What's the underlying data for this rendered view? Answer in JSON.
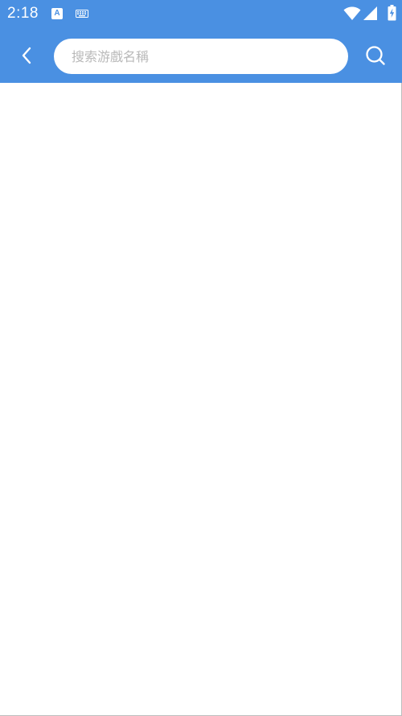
{
  "status_bar": {
    "time": "2:18",
    "notification_icons": [
      "a-notification-icon",
      "keyboard-icon"
    ],
    "system_icons": [
      "wifi-icon",
      "cellular-signal-icon",
      "battery-charging-icon"
    ]
  },
  "app_bar": {
    "back_icon": "chevron-left-icon",
    "search_placeholder": "搜索游戲名稱",
    "search_value": "",
    "search_icon": "search-icon"
  },
  "colors": {
    "primary": "#4a90e2",
    "surface": "#ffffff",
    "placeholder": "#b9b9b9"
  }
}
